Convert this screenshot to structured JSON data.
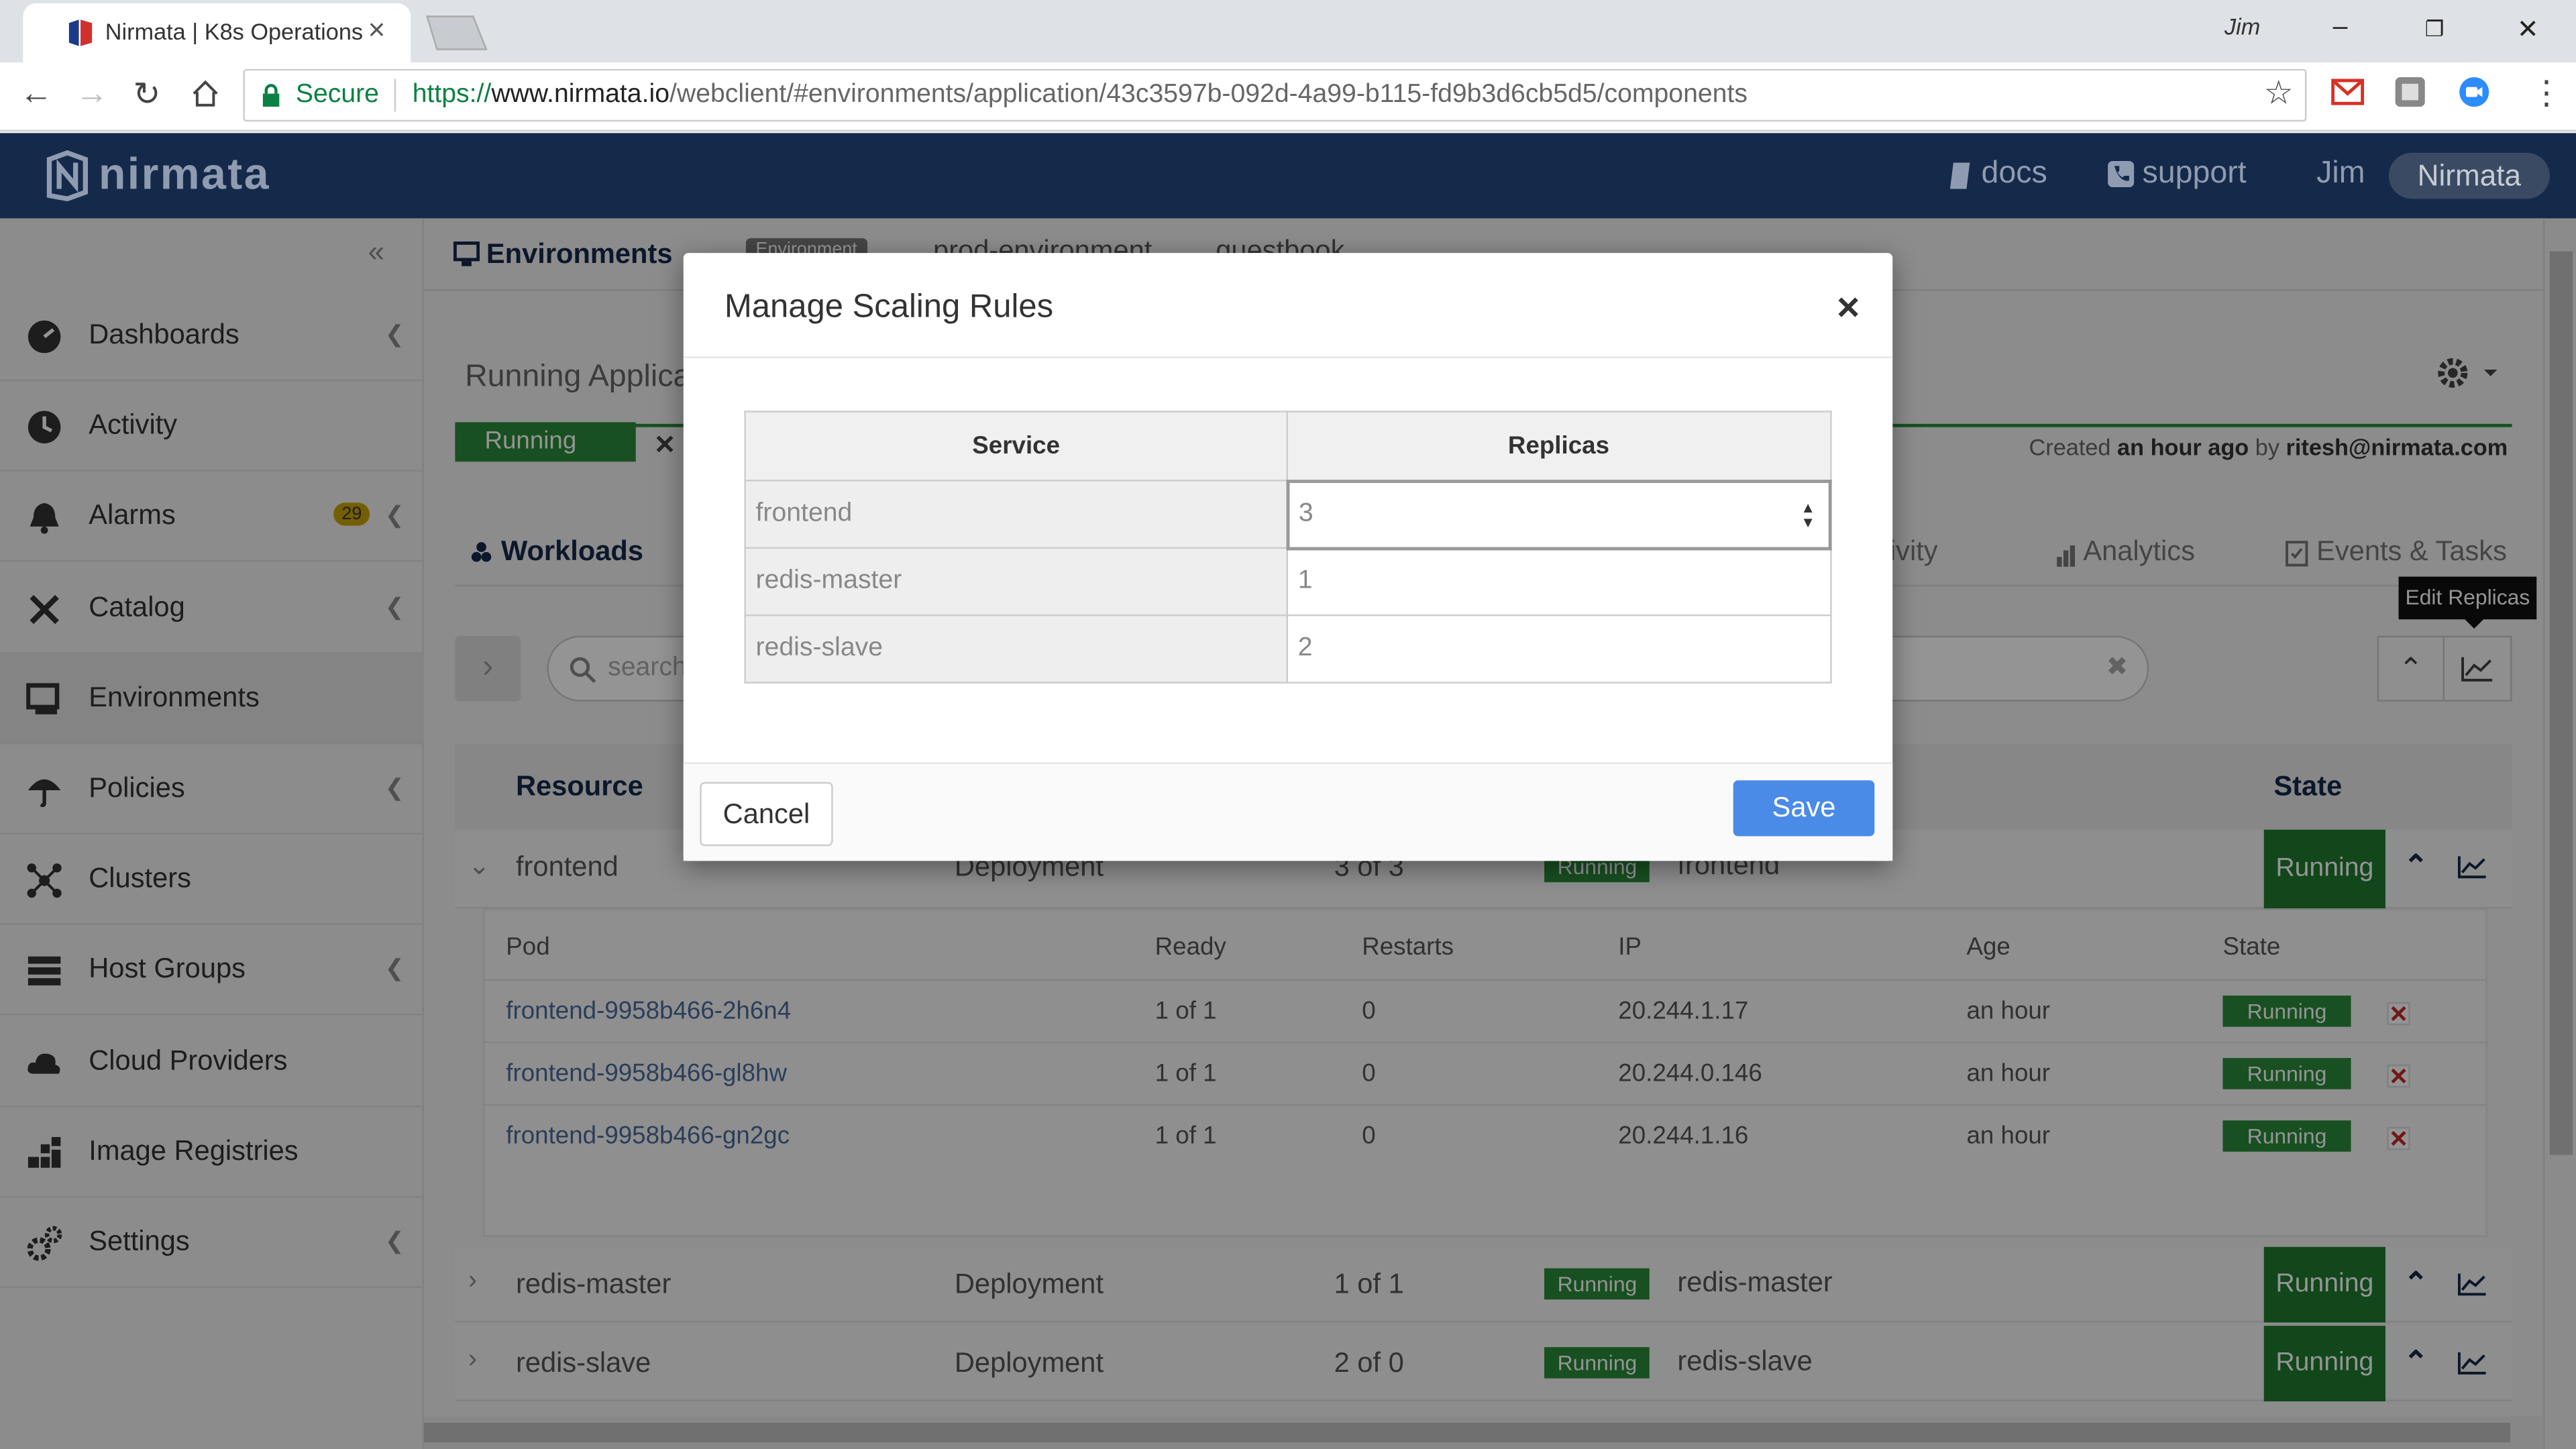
{
  "browser": {
    "tab_title": "Nirmata | K8s Operations",
    "profile": "Jim",
    "secure_label": "Secure",
    "url_scheme": "https://",
    "url_host": "www.nirmata.io",
    "url_path": "/webclient/#environments/application/43c3597b-092d-4a99-b115-fd9b3d6cb5d5/components"
  },
  "app": {
    "logo": "nirmata",
    "docs": "docs",
    "support": "support",
    "user": "Jim",
    "org": "Nirmata"
  },
  "sidebar": {
    "items": [
      {
        "label": "Dashboards",
        "icon": "dashboard-icon",
        "chevron": true
      },
      {
        "label": "Activity",
        "icon": "activity-icon",
        "chevron": false
      },
      {
        "label": "Alarms",
        "icon": "bell-icon",
        "chevron": true,
        "badge": "29"
      },
      {
        "label": "Catalog",
        "icon": "catalog-icon",
        "chevron": true
      },
      {
        "label": "Environments",
        "icon": "monitor-icon",
        "chevron": false,
        "active": true
      },
      {
        "label": "Policies",
        "icon": "umbrella-icon",
        "chevron": true
      },
      {
        "label": "Clusters",
        "icon": "cluster-icon",
        "chevron": false
      },
      {
        "label": "Host Groups",
        "icon": "server-icon",
        "chevron": true
      },
      {
        "label": "Cloud Providers",
        "icon": "cloud-icon",
        "chevron": false
      },
      {
        "label": "Image Registries",
        "icon": "registry-icon",
        "chevron": false
      },
      {
        "label": "Settings",
        "icon": "gear-icon",
        "chevron": true
      }
    ]
  },
  "page": {
    "breadcrumb_root": "Environments",
    "breadcrumb_env_tag": "Environment",
    "breadcrumb_env": "prod-environment",
    "breadcrumb_app": "guestbook",
    "app_title": "Running Applica",
    "app_state": "Running",
    "created_prefix": "Created",
    "created_when": "an hour ago",
    "created_by_prefix": "by",
    "created_by": "ritesh@nirmata.com",
    "tab_workloads": "Workloads",
    "tab_activity": "ctivity",
    "tab_analytics": "Analytics",
    "tab_events": "Events & Tasks",
    "search_placeholder": "search",
    "tooltip": "Edit Replicas",
    "col_resource": "Resource",
    "col_state": "State"
  },
  "workloads": [
    {
      "name": "frontend",
      "type": "Deployment",
      "ready": "3 of 3",
      "status": "Running",
      "label": "frontend",
      "state": "Running"
    },
    {
      "name": "redis-master",
      "type": "Deployment",
      "ready": "1 of 1",
      "status": "Running",
      "label": "redis-master",
      "state": "Running"
    },
    {
      "name": "redis-slave",
      "type": "Deployment",
      "ready": "2 of 0",
      "status": "Running",
      "label": "redis-slave",
      "state": "Running"
    }
  ],
  "pods": {
    "headers": [
      "Pod",
      "Ready",
      "Restarts",
      "IP",
      "Age",
      "State"
    ],
    "rows": [
      {
        "pod": "frontend-9958b466-2h6n4",
        "ready": "1 of 1",
        "restarts": "0",
        "ip": "20.244.1.17",
        "age": "an hour",
        "state": "Running"
      },
      {
        "pod": "frontend-9958b466-gl8hw",
        "ready": "1 of 1",
        "restarts": "0",
        "ip": "20.244.0.146",
        "age": "an hour",
        "state": "Running"
      },
      {
        "pod": "frontend-9958b466-gn2gc",
        "ready": "1 of 1",
        "restarts": "0",
        "ip": "20.244.1.16",
        "age": "an hour",
        "state": "Running"
      }
    ]
  },
  "modal": {
    "title": "Manage Scaling Rules",
    "close": "×",
    "col_service": "Service",
    "col_replicas": "Replicas",
    "rules": [
      {
        "service": "frontend",
        "replicas": "3"
      },
      {
        "service": "redis-master",
        "replicas": "1"
      },
      {
        "service": "redis-slave",
        "replicas": "2"
      }
    ],
    "cancel": "Cancel",
    "save": "Save"
  },
  "colors": {
    "appbar": "#15294a",
    "running": "#2a8a3a",
    "save_button": "#4a8be8"
  }
}
